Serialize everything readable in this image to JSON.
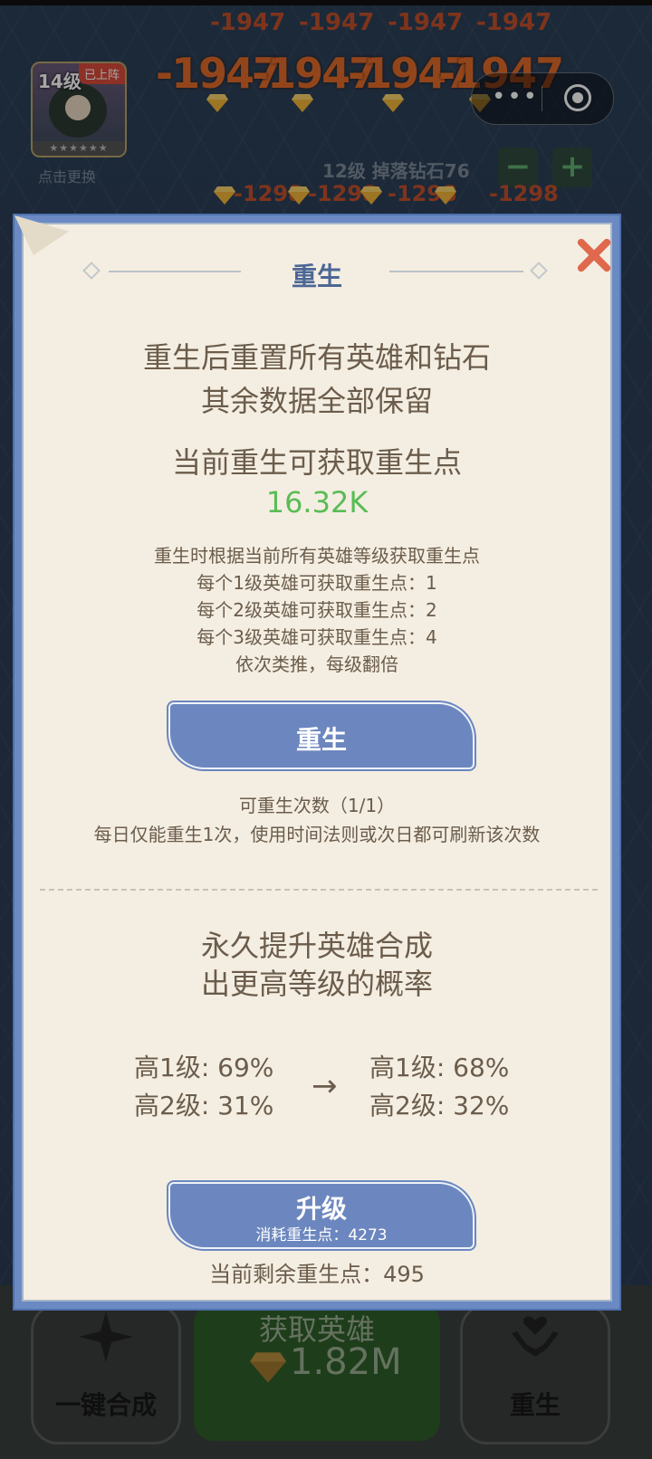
{
  "game": {
    "damage_top": [
      "-1947",
      "-1947",
      "-1947",
      "-1947"
    ],
    "damage_big": [
      "-1947",
      "-1947",
      "-1947",
      "-1947"
    ],
    "damage_mid": [
      "-1298",
      "-1298",
      "-1298",
      "-1298"
    ],
    "hero": {
      "level": "14级",
      "tag": "已上阵",
      "stars": "★★★★★★",
      "change_hint": "点击更换"
    },
    "level_drop": "12级 掉落钻石76",
    "minus": "−",
    "plus": "+"
  },
  "miniapp_capsule": {
    "more_icon": "more-dots-icon",
    "close_icon": "target-circle-icon"
  },
  "bottom_bar": {
    "merge_label": "一键合成",
    "gain_title": "获取英雄",
    "gain_cost": "1.82M",
    "rebirth_label": "重生"
  },
  "modal": {
    "title": "重生",
    "desc_line1": "重生后重置所有英雄和钻石",
    "desc_line2": "其余数据全部保留",
    "points_heading": "当前重生可获取重生点",
    "points_value": "16.32K",
    "rules": [
      "重生时根据当前所有英雄等级获取重生点",
      "每个1级英雄可获取重生点：1",
      "每个2级英雄可获取重生点：2",
      "每个3级英雄可获取重生点：4",
      "依次类推，每级翻倍"
    ],
    "rebirth_button": "重生",
    "rebirth_count": "可重生次数（1/1）",
    "rebirth_note": "每日仅能重生1次，使用时间法则或次日都可刷新该次数",
    "upgrade_heading_line1": "永久提升英雄合成",
    "upgrade_heading_line2": "出更高等级的概率",
    "current_probs": [
      "高1级: 69%",
      "高2级: 31%"
    ],
    "arrow": "→",
    "next_probs": [
      "高1级: 68%",
      "高2级: 32%"
    ],
    "upgrade_button": "升级",
    "upgrade_cost": "消耗重生点：4273",
    "remaining_points": "当前剩余重生点：495"
  },
  "colors": {
    "accent_blue": "#6c87bf",
    "title_blue": "#4d6795",
    "green": "#5abc55",
    "close_red": "#e0684d",
    "panel": "#f4eee2"
  }
}
